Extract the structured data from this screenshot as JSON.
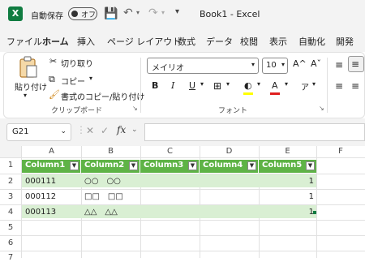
{
  "titlebar": {
    "app_icon": "X",
    "autosave_label": "自動保存",
    "toggle_label": "オフ",
    "qat_more": "▾",
    "doc_title": "Book1 - Excel"
  },
  "menu": {
    "items": [
      "ファイル",
      "ホーム",
      "挿入",
      "ページ レイアウト",
      "数式",
      "データ",
      "校閲",
      "表示",
      "自動化",
      "開発"
    ]
  },
  "ribbon": {
    "paste_label": "貼り付け",
    "cut_label": "切り取り",
    "copy_label": "コピー",
    "format_painter_label": "書式のコピー/貼り付け",
    "clipboard_group": "クリップボード",
    "font_name": "メイリオ",
    "font_size": "10",
    "font_group": "フォント",
    "bold": "B",
    "italic": "I",
    "underline": "U",
    "grow_font": "A^",
    "shrink_font": "Aˇ",
    "font_color": "A"
  },
  "formula_bar": {
    "name_box": "G21",
    "fx": "fx",
    "value": ""
  },
  "sheet": {
    "columns": [
      "A",
      "B",
      "C",
      "D",
      "E",
      "F"
    ],
    "rows": [
      "1",
      "2",
      "3",
      "4",
      "5",
      "6",
      "7"
    ],
    "table_headers": [
      "Column1",
      "Column2",
      "Column3",
      "Column4",
      "Column5"
    ],
    "table_rows": [
      [
        "000111",
        "○○　○○",
        "",
        "",
        "1"
      ],
      [
        "000112",
        "□□　□□",
        "",
        "",
        "1"
      ],
      [
        "000113",
        "△△　△△",
        "",
        "",
        "1"
      ]
    ]
  },
  "colors": {
    "excel_green": "#107c41",
    "table_header": "#5eb346",
    "table_band": "#d9efd3"
  }
}
